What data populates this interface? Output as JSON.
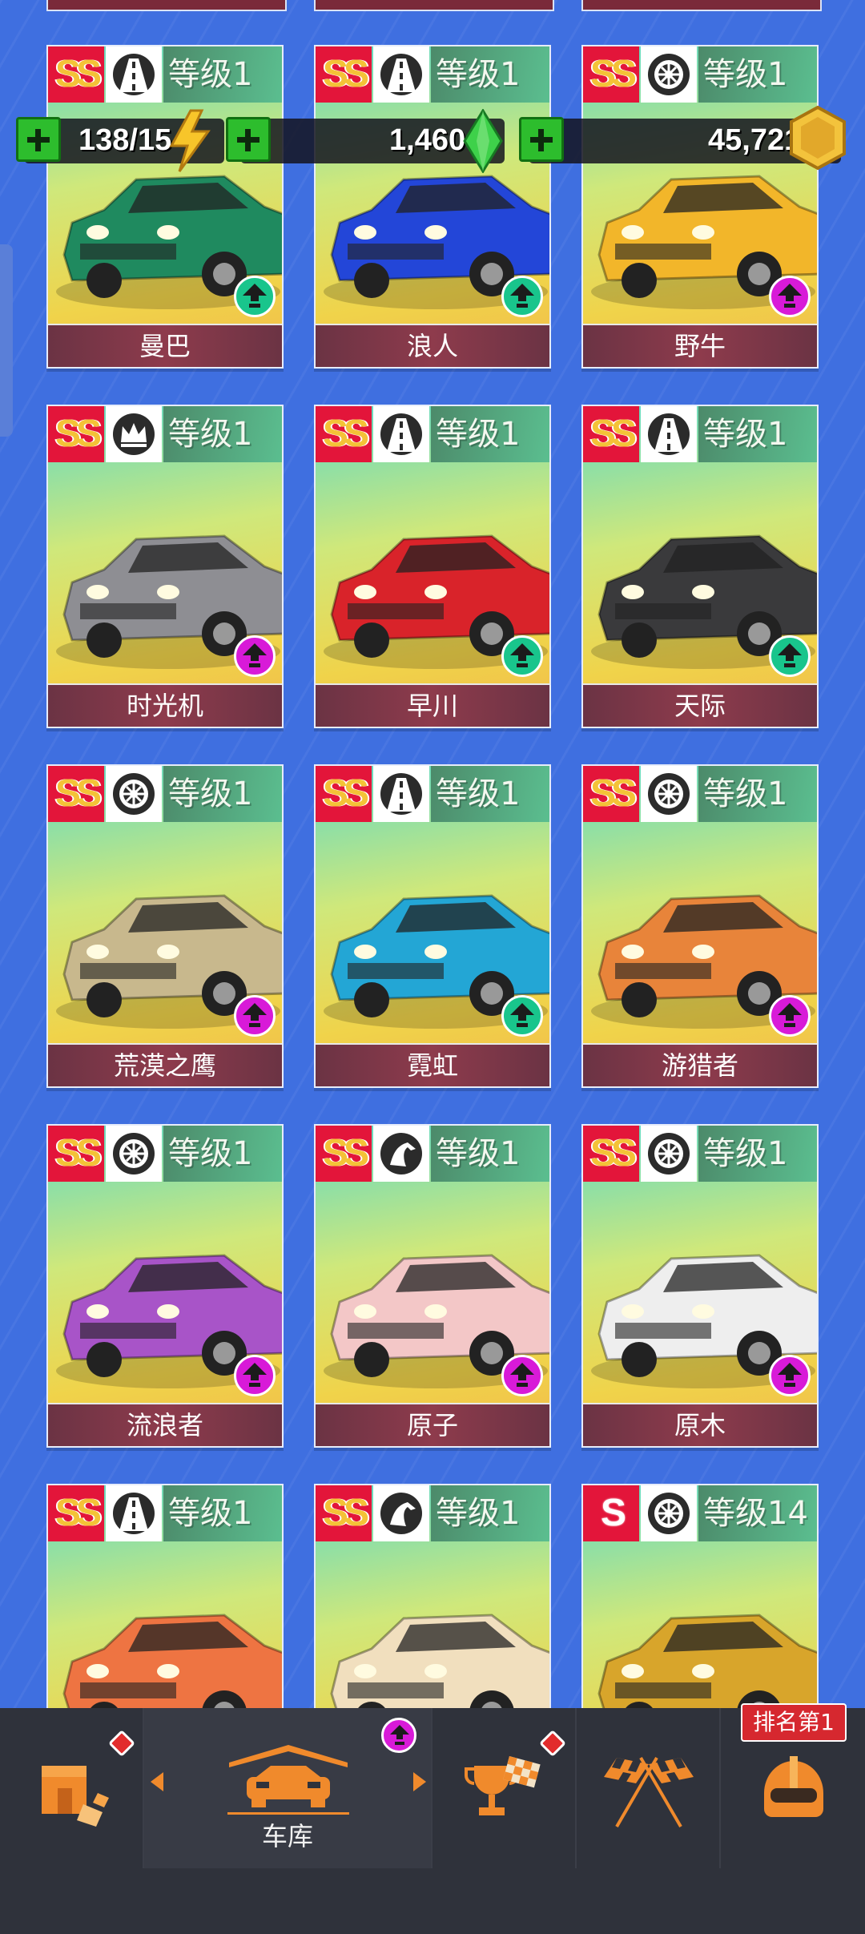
{
  "resources": {
    "energy": {
      "value": "138/15",
      "icon": "lightning-icon"
    },
    "gems": {
      "value": "1,460",
      "icon": "green-gem-icon"
    },
    "coins": {
      "value": "45,721",
      "icon": "gold-coin-icon"
    }
  },
  "cards": [
    {
      "rank": "SS",
      "type_icon": "road-icon",
      "level": "等级1",
      "name": "曼巴",
      "upgrade": "green",
      "car_color": "#1f8a5f"
    },
    {
      "rank": "SS",
      "type_icon": "road-icon",
      "level": "等级1",
      "name": "浪人",
      "upgrade": "green",
      "car_color": "#2346d8"
    },
    {
      "rank": "SS",
      "type_icon": "tire-icon",
      "level": "等级1",
      "name": "野牛",
      "upgrade": "magenta",
      "car_color": "#f2b62a"
    },
    {
      "rank": "SS",
      "type_icon": "crown-icon",
      "level": "等级1",
      "name": "时光机",
      "upgrade": "magenta",
      "car_color": "#8e8e93"
    },
    {
      "rank": "SS",
      "type_icon": "road-icon",
      "level": "等级1",
      "name": "早川",
      "upgrade": "green",
      "car_color": "#d9232a"
    },
    {
      "rank": "SS",
      "type_icon": "road-icon",
      "level": "等级1",
      "name": "天际",
      "upgrade": "green",
      "car_color": "#3a3a3c"
    },
    {
      "rank": "SS",
      "type_icon": "tire-icon",
      "level": "等级1",
      "name": "荒漠之鹰",
      "upgrade": "magenta",
      "car_color": "#c8b88d"
    },
    {
      "rank": "SS",
      "type_icon": "road-icon",
      "level": "等级1",
      "name": "霓虹",
      "upgrade": "green",
      "car_color": "#23a6d5"
    },
    {
      "rank": "SS",
      "type_icon": "tire-icon",
      "level": "等级1",
      "name": "游猎者",
      "upgrade": "magenta",
      "car_color": "#e8843a"
    },
    {
      "rank": "SS",
      "type_icon": "tire-icon",
      "level": "等级1",
      "name": "流浪者",
      "upgrade": "magenta",
      "car_color": "#a854c8"
    },
    {
      "rank": "SS",
      "type_icon": "horse-icon",
      "level": "等级1",
      "name": "原子",
      "upgrade": "magenta",
      "car_color": "#f3c7c7"
    },
    {
      "rank": "SS",
      "type_icon": "tire-icon",
      "level": "等级1",
      "name": "原木",
      "upgrade": "magenta",
      "car_color": "#eeeeee"
    },
    {
      "rank": "SS",
      "type_icon": "road-icon",
      "level": "等级1",
      "name": "",
      "upgrade": "",
      "car_color": "#ee7442"
    },
    {
      "rank": "SS",
      "type_icon": "horse-icon",
      "level": "等级1",
      "name": "",
      "upgrade": "",
      "car_color": "#f1dfbe"
    },
    {
      "rank": "S",
      "type_icon": "tire-icon",
      "level": "等级14",
      "name": "",
      "upgrade": "",
      "car_color": "#d8a52b"
    }
  ],
  "nav": {
    "shop_icon": "shop-icon",
    "garage_label": "车库",
    "trophy_icon": "trophy-icon",
    "race_icon": "checkered-flags-icon",
    "rank_tag": "排名第1",
    "profile_icon": "helmet-icon"
  },
  "colors": {
    "background": "#3f6fe0",
    "upgrade_green": "#19c58c",
    "upgrade_magenta": "#d81ad8",
    "name_bar": "#7a3444",
    "nav_bg": "#2f323b",
    "accent_orange": "#f08a2c"
  }
}
